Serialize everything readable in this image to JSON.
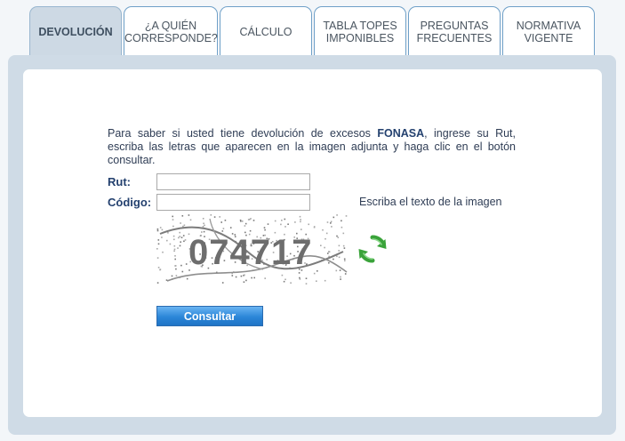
{
  "tabs": [
    {
      "label": "DEVOLUCIÓN",
      "active": true
    },
    {
      "label": "¿A QUIÉN CORRESPONDE?"
    },
    {
      "label": "CÁLCULO"
    },
    {
      "label": "TABLA TOPES IMPONIBLES"
    },
    {
      "label": "PREGUNTAS FRECUENTES"
    },
    {
      "label": "NORMATIVA VIGENTE"
    }
  ],
  "form": {
    "intro_before": "Para saber si usted tiene devolución de excesos ",
    "intro_brand": "FONASA",
    "intro_after": ", ingrese su Rut, escriba las letras que aparecen en la imagen adjunta y haga clic en el botón consultar.",
    "rut_label": "Rut:",
    "rut_value": "",
    "codigo_label": "Código:",
    "codigo_value": "",
    "hint": "Escriba el texto de la imagen",
    "captcha_text": "074717",
    "submit_label": "Consultar"
  },
  "icons": {
    "refresh": "refresh-icon"
  },
  "colors": {
    "tab_active_bg": "#cdd9e4",
    "panel_bg": "#cfdbe6",
    "label_color": "#24416f",
    "button_blue": "#2b86d8",
    "refresh_green": "#3aa33a"
  }
}
